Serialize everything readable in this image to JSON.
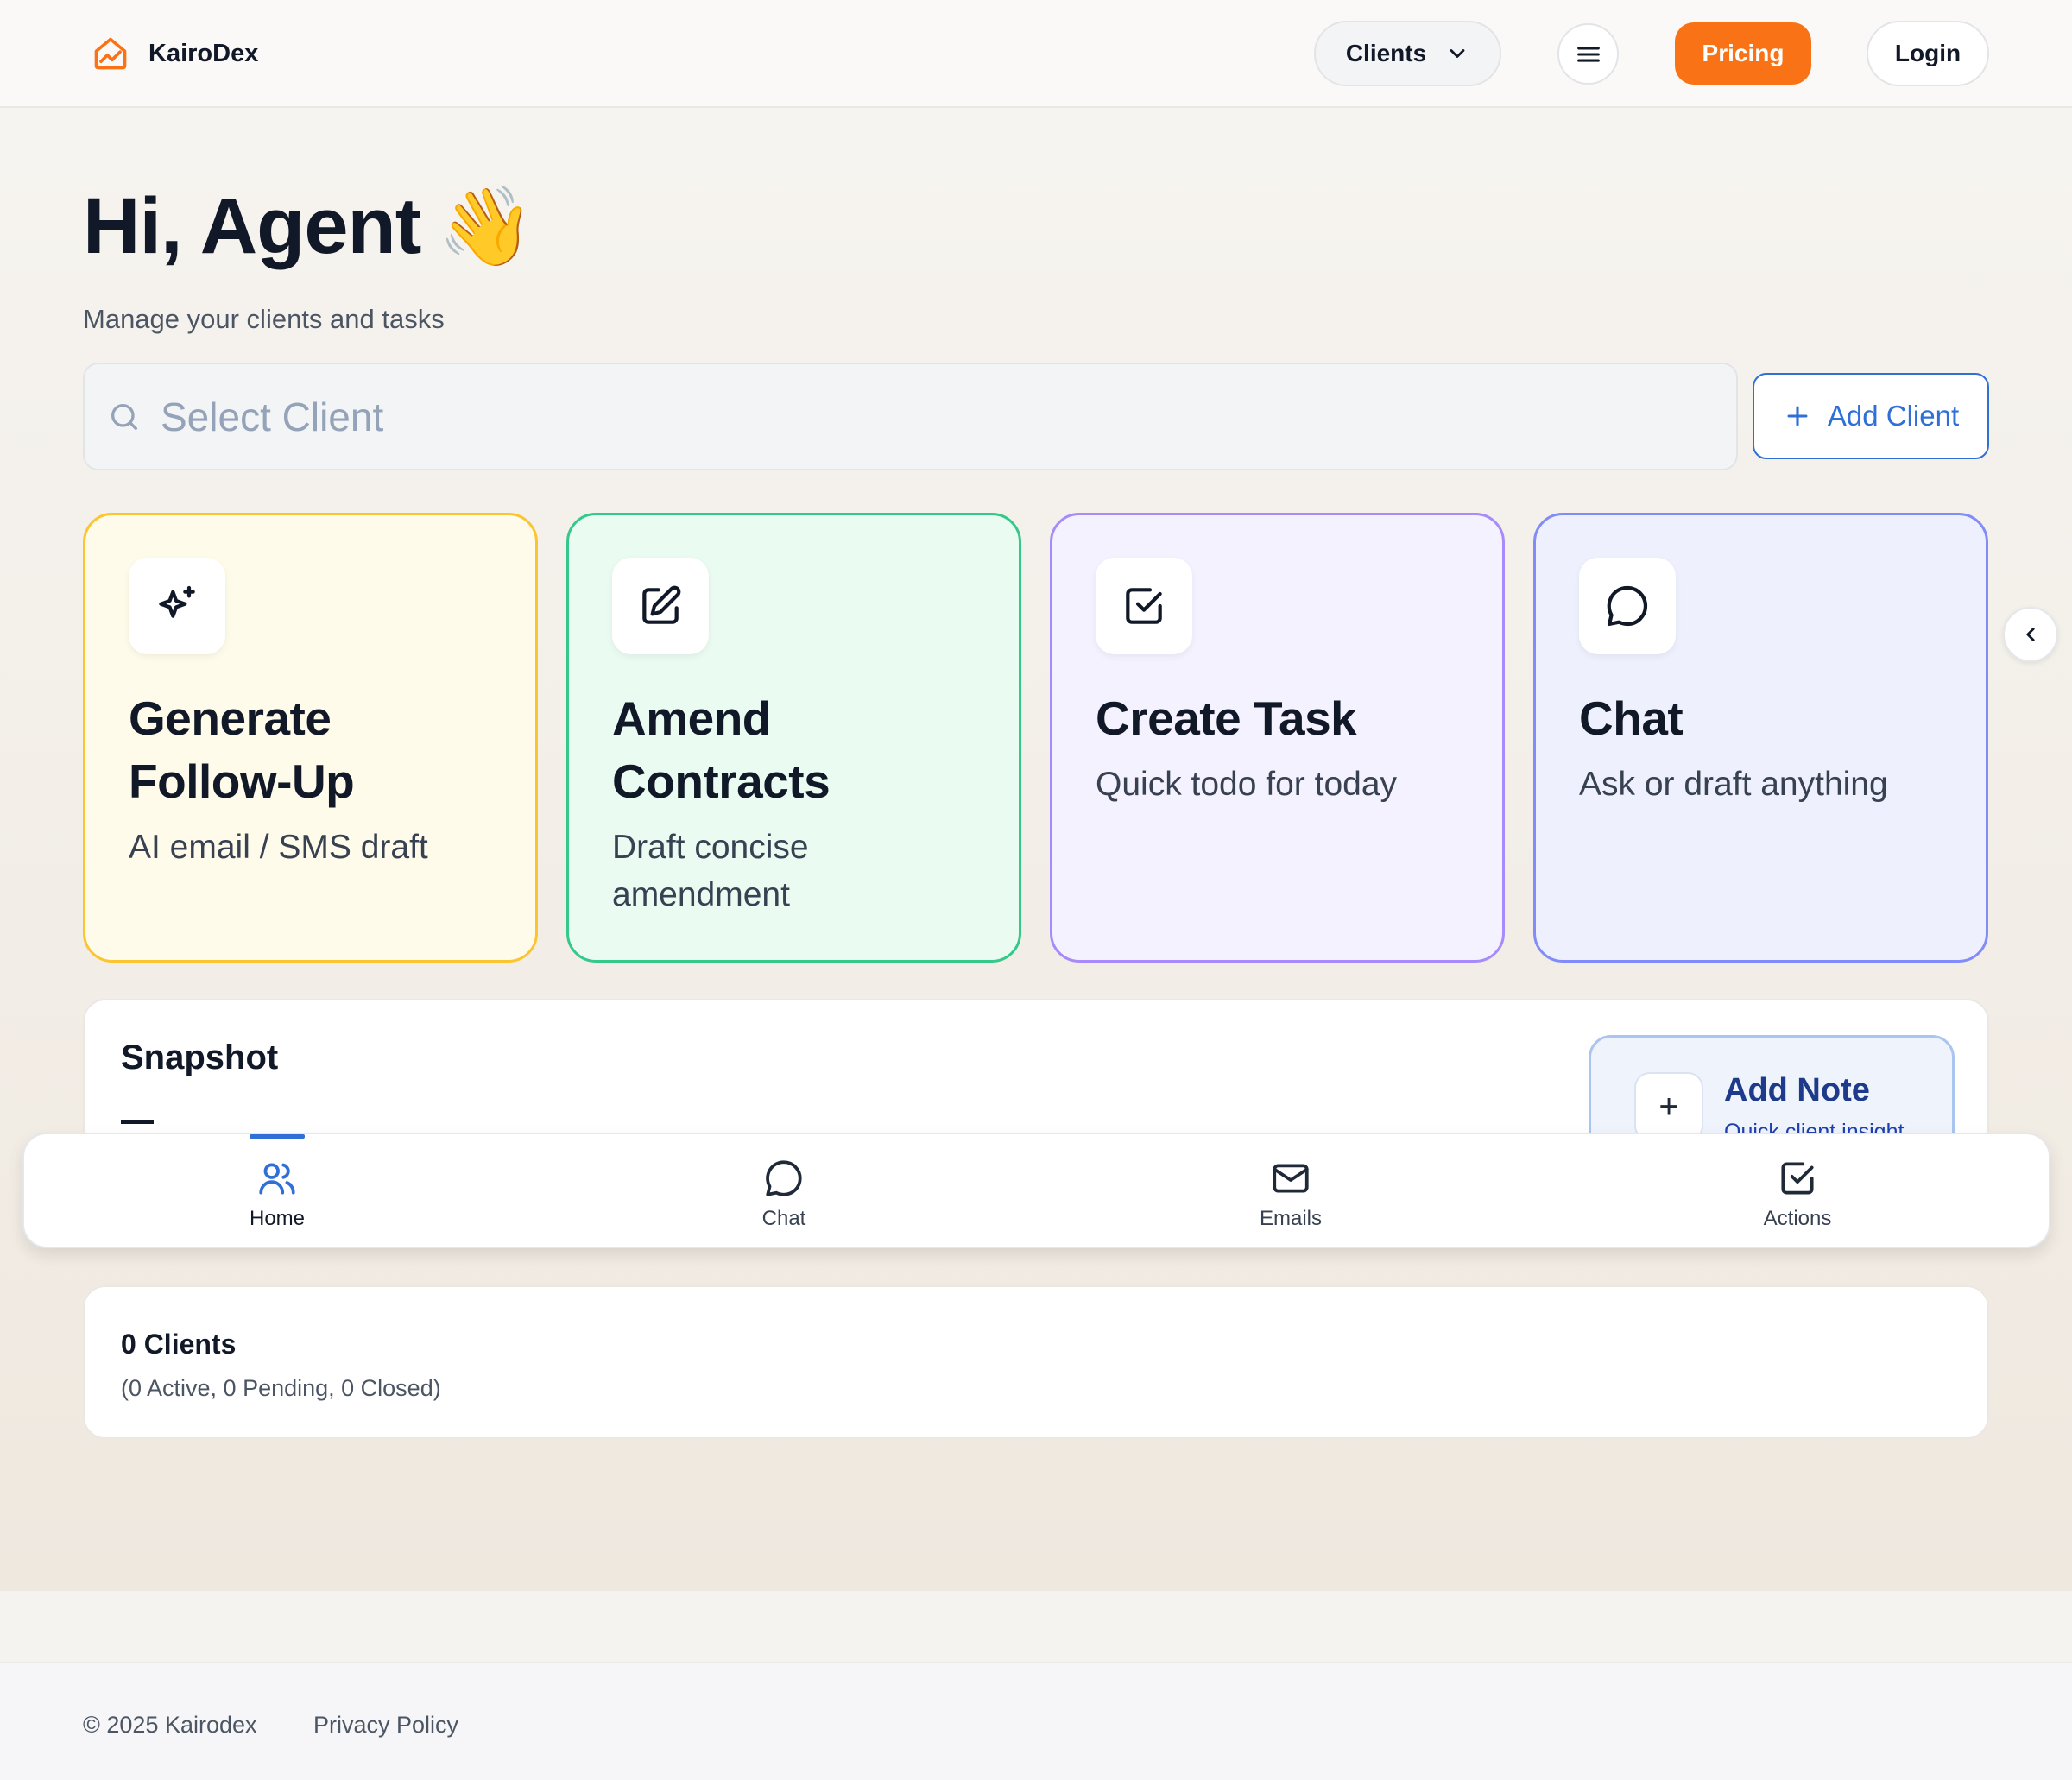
{
  "brand": {
    "name": "KairoDex",
    "logo_icon": "chart-house-icon",
    "accent": "#f97316"
  },
  "header": {
    "clients_dropdown": "Clients",
    "menu_icon": "hamburger-icon",
    "pricing_label": "Pricing",
    "login_label": "Login"
  },
  "greeting": {
    "title": "Hi, Agent",
    "emoji": "👋",
    "subtitle": "Manage your clients and tasks"
  },
  "search": {
    "placeholder": "Select Client",
    "value": ""
  },
  "add_client_label": "Add Client",
  "cards": [
    {
      "icon": "sparkle-icon",
      "title": "Generate Follow-Up",
      "desc": "AI email / SMS draft",
      "border": "#fbc531",
      "bg": "#fffbea"
    },
    {
      "icon": "edit-icon",
      "title": "Amend Contracts",
      "desc": "Draft concise amendment",
      "border": "#34c98a",
      "bg": "#eafbf2"
    },
    {
      "icon": "checkbox-icon",
      "title": "Create Task",
      "desc": "Quick todo for today",
      "border": "#a78bfa",
      "bg": "#f4f2fe"
    },
    {
      "icon": "chat-bubble-icon",
      "title": "Chat",
      "desc": "Ask or draft anything",
      "border": "#818cf8",
      "bg": "#eef1fd"
    }
  ],
  "snapshot": {
    "title": "Snapshot",
    "add_note": {
      "title": "Add Note",
      "subtitle": "Quick client insight",
      "icon": "plus-icon"
    }
  },
  "bottom_nav": [
    {
      "label": "Home",
      "icon": "users-icon",
      "active": true
    },
    {
      "label": "Chat",
      "icon": "chat-bubble-icon",
      "active": false
    },
    {
      "label": "Emails",
      "icon": "mail-icon",
      "active": false
    },
    {
      "label": "Actions",
      "icon": "checkbox-icon",
      "active": false
    }
  ],
  "clients_summary": {
    "count_label": "0 Clients",
    "breakdown": "(0 Active, 0 Pending, 0 Closed)"
  },
  "footer": {
    "copyright": "© 2025 Kairodex",
    "privacy": "Privacy Policy"
  },
  "colors": {
    "primary_blue": "#2f6fd6",
    "text_dark": "#111827"
  }
}
